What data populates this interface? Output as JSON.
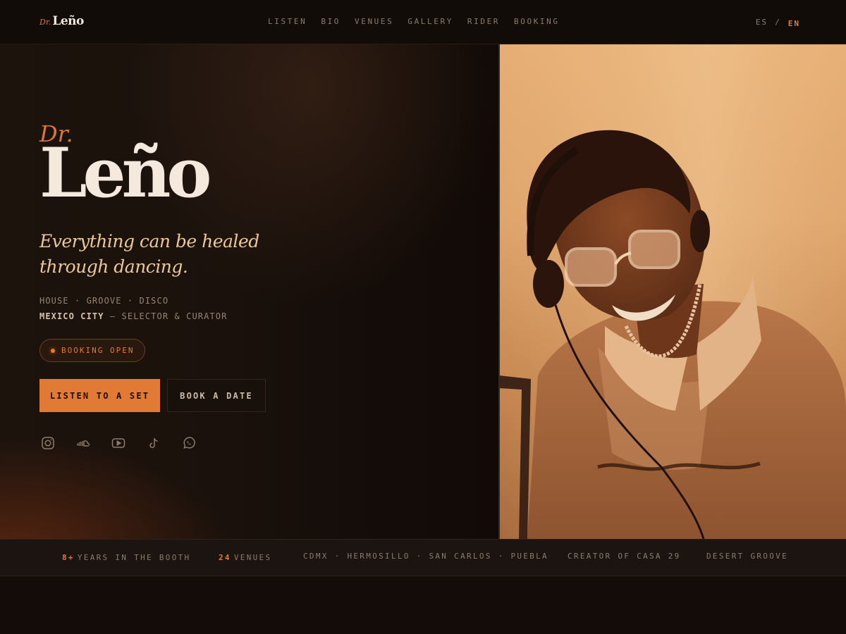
{
  "brand": {
    "prefix": "Dr.",
    "name": "Leño"
  },
  "nav": {
    "items": [
      "LISTEN",
      "BIO",
      "VENUES",
      "GALLERY",
      "RIDER",
      "BOOKING"
    ],
    "lang": {
      "es": "ES",
      "sep": "/",
      "en": "EN",
      "active": "EN"
    }
  },
  "hero": {
    "prefix": "Dr.",
    "name": "Leño",
    "tagline": "Everything can be healed through dancing.",
    "genres": "HOUSE · GROOVE · DISCO",
    "city": "MEXICO CITY",
    "role": "— SELECTOR & CURATOR",
    "badge": "BOOKING OPEN",
    "primary_cta": "LISTEN TO A SET",
    "secondary_cta": "BOOK A DATE"
  },
  "socials": [
    {
      "icon": "instagram-icon"
    },
    {
      "icon": "soundcloud-icon"
    },
    {
      "icon": "youtube-icon"
    },
    {
      "icon": "tiktok-icon"
    },
    {
      "icon": "whatsapp-icon"
    }
  ],
  "stats": {
    "years_num": "8+",
    "years_label": "YEARS IN THE BOOTH",
    "venues_num": "24",
    "venues_label": "VENUES",
    "cities": "CDMX · HERMOSILLO · SAN CARLOS · PUEBLA",
    "creator": "CREATOR OF CASA 29",
    "desert": "DESERT GROOVE"
  },
  "colors": {
    "accent": "#e07a34",
    "background": "#140d09",
    "cream": "#f4e9dc"
  }
}
